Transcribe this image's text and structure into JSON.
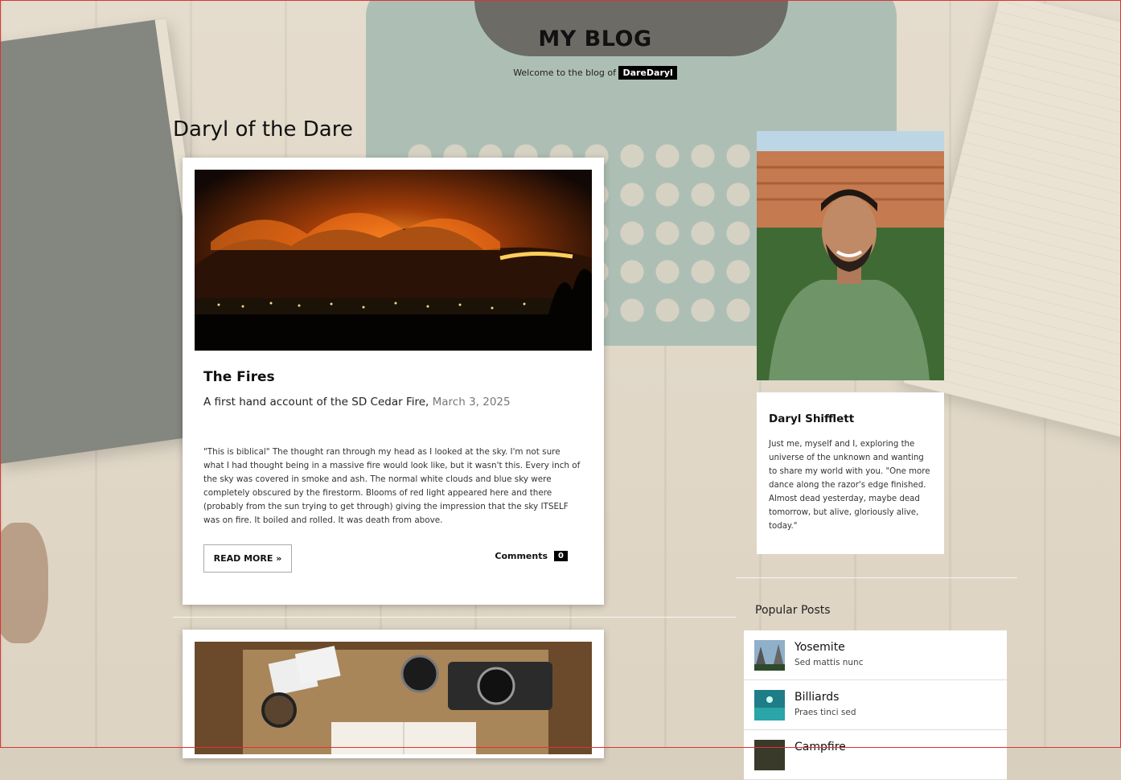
{
  "header": {
    "site_title": "MY BLOG",
    "tagline_prefix": "Welcome to the blog of",
    "author_handle": "DareDaryl"
  },
  "page": {
    "heading": "Daryl of the Dare"
  },
  "posts": [
    {
      "title": "The Fires",
      "subtitle": "A first hand account of the SD Cedar Fire,",
      "date": "March 3, 2025",
      "excerpt": "\"This is biblical\" The thought ran through my head as I looked at the sky. I'm not sure what I had thought being in a massive fire would look like, but it wasn't this. Every inch of the sky was covered in smoke and ash. The normal white clouds and blue sky were completely obscured by the firestorm. Blooms of red light appeared here and there (probably from the sun trying to get through) giving the impression that the sky ITSELF was on fire. It boiled and rolled. It was death from above.",
      "read_more_label": "READ MORE »",
      "comments_label": "Comments",
      "comments_count": "0"
    }
  ],
  "sidebar": {
    "profile": {
      "name": "Daryl Shifflett",
      "bio": "Just me, myself and I, exploring the universe of the unknown and wanting to share my world with you. \"One more dance along the razor's edge finished. Almost dead yesterday, maybe dead tomorrow, but alive, gloriously alive, today.\""
    },
    "popular": {
      "heading": "Popular Posts",
      "items": [
        {
          "title": "Yosemite",
          "subtitle": "Sed mattis nunc"
        },
        {
          "title": "Billiards",
          "subtitle": "Praes tinci sed"
        },
        {
          "title": "Campfire",
          "subtitle": ""
        }
      ]
    }
  },
  "colors": {
    "chip_bg": "#000000",
    "card_bg": "#ffffff",
    "date_gray": "#777777"
  }
}
